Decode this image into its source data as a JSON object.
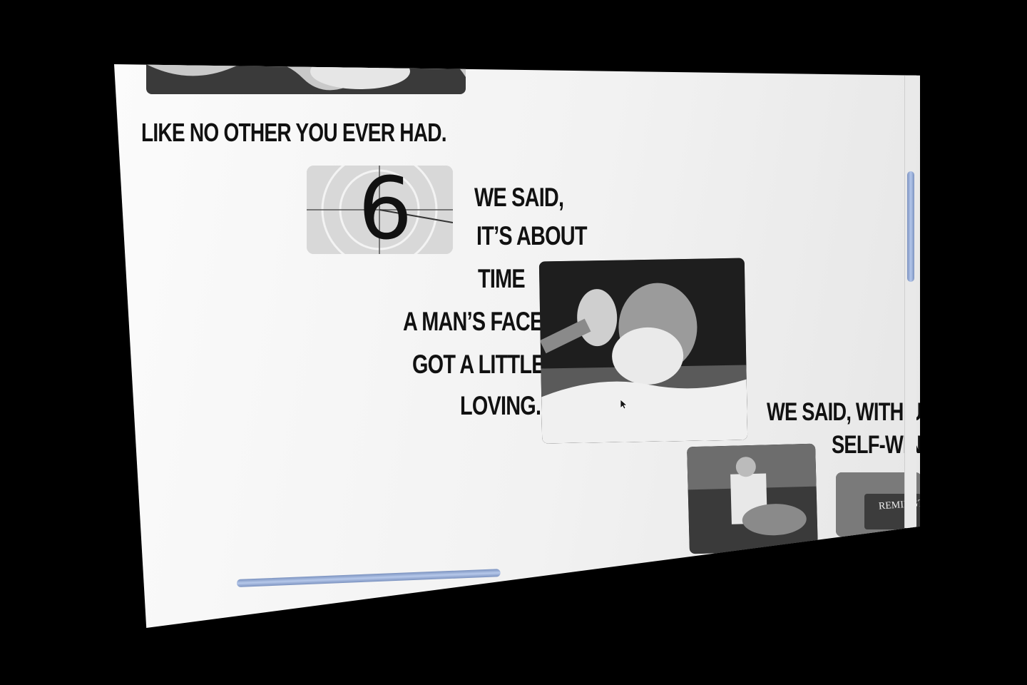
{
  "story": {
    "line_top": "LIKE NO OTHER YOU EVER HAD.",
    "countdown_number": "6",
    "col1": [
      "WE SAID,",
      "IT’S ABOUT",
      "TIME",
      "A MAN’S FACE",
      "GOT A LITTLE",
      "LOVING."
    ],
    "col2": [
      "WE SAID, WITH UBIK’S",
      "SELF-WINDIN"
    ],
    "brand_sign": "REMINGTO"
  },
  "images": {
    "top": "barbershop-photo",
    "countdown": "film-countdown",
    "shaving": "man-being-shaved-photo",
    "barber": "barber-photo",
    "razor": "remington-razor-photo"
  }
}
